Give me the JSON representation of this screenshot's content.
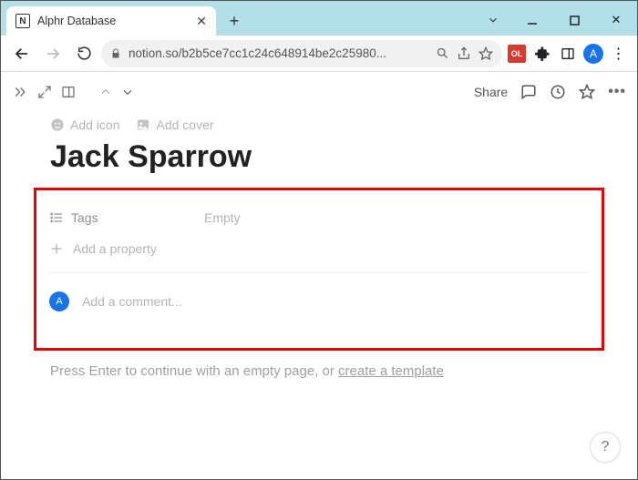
{
  "browser": {
    "tab_title": "Alphr Database",
    "url_display": "notion.so/b2b5ce7cc1c24c648914be2c25980...",
    "avatar_letter": "A",
    "ext_badge": "OL"
  },
  "notion": {
    "share_label": "Share"
  },
  "page": {
    "add_icon_label": "Add icon",
    "add_cover_label": "Add cover",
    "title": "Jack Sparrow",
    "properties": [
      {
        "name": "Tags",
        "value": "Empty"
      }
    ],
    "add_property_label": "Add a property",
    "comment_avatar_letter": "A",
    "comment_placeholder": "Add a comment...",
    "hint_prefix": "Press Enter to continue with an empty page, or ",
    "hint_link": "create a template"
  },
  "help_label": "?"
}
